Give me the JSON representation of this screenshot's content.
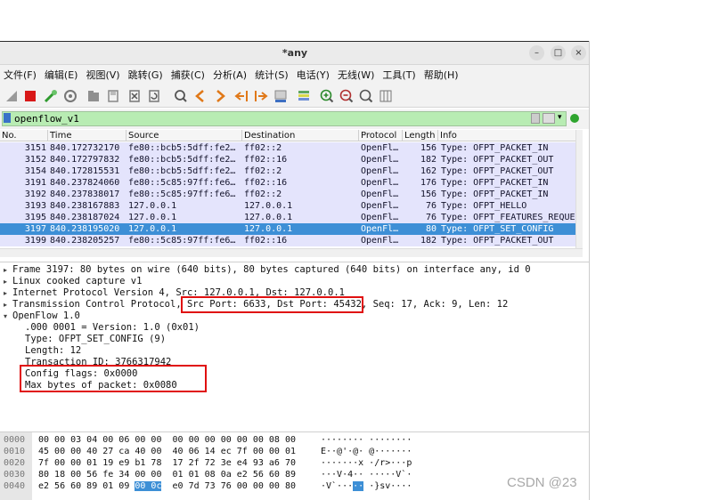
{
  "window": {
    "title": "*any",
    "minimize": "–",
    "maximize": "□",
    "close": "×"
  },
  "menu": [
    "文件(F)",
    "编辑(E)",
    "视图(V)",
    "跳转(G)",
    "捕获(C)",
    "分析(A)",
    "统计(S)",
    "电话(Y)",
    "无线(W)",
    "工具(T)",
    "帮助(H)"
  ],
  "filter": {
    "value": "openflow_v1"
  },
  "packet_list": {
    "columns": [
      "No.",
      "Time",
      "Source",
      "Destination",
      "Protocol",
      "Length",
      "Info"
    ],
    "rows": [
      {
        "no": "3151",
        "time": "840.172732170",
        "src": "fe80::bcb5:5dff:fe2…",
        "dst": "ff02::2",
        "proto": "OpenFl…",
        "len": "156",
        "info": "Type: OFPT_PACKET_IN"
      },
      {
        "no": "3152",
        "time": "840.172797832",
        "src": "fe80::bcb5:5dff:fe2…",
        "dst": "ff02::16",
        "proto": "OpenFl…",
        "len": "182",
        "info": "Type: OFPT_PACKET_OUT"
      },
      {
        "no": "3154",
        "time": "840.172815531",
        "src": "fe80::bcb5:5dff:fe2…",
        "dst": "ff02::2",
        "proto": "OpenFl…",
        "len": "162",
        "info": "Type: OFPT_PACKET_OUT"
      },
      {
        "no": "3191",
        "time": "840.237824060",
        "src": "fe80::5c85:97ff:fe6…",
        "dst": "ff02::16",
        "proto": "OpenFl…",
        "len": "176",
        "info": "Type: OFPT_PACKET_IN"
      },
      {
        "no": "3192",
        "time": "840.237838017",
        "src": "fe80::5c85:97ff:fe6…",
        "dst": "ff02::2",
        "proto": "OpenFl…",
        "len": "156",
        "info": "Type: OFPT_PACKET_IN"
      },
      {
        "no": "3193",
        "time": "840.238167883",
        "src": "127.0.0.1",
        "dst": "127.0.0.1",
        "proto": "OpenFl…",
        "len": "76",
        "info": "Type: OFPT_HELLO"
      },
      {
        "no": "3195",
        "time": "840.238187024",
        "src": "127.0.0.1",
        "dst": "127.0.0.1",
        "proto": "OpenFl…",
        "len": "76",
        "info": "Type: OFPT_FEATURES_REQUE:"
      },
      {
        "no": "3197",
        "time": "840.238195020",
        "src": "127.0.0.1",
        "dst": "127.0.0.1",
        "proto": "OpenFl…",
        "len": "80",
        "info": "Type: OFPT_SET_CONFIG"
      },
      {
        "no": "3199",
        "time": "840.238205257",
        "src": "fe80::5c85:97ff:fe6…",
        "dst": "ff02::16",
        "proto": "OpenFl…",
        "len": "182",
        "info": "Type: OFPT_PACKET_OUT"
      }
    ]
  },
  "details": {
    "frame": "Frame 3197: 80 bytes on wire (640 bits), 80 bytes captured (640 bits) on interface any, id 0",
    "linux": "Linux cooked capture v1",
    "ip": "Internet Protocol Version 4, Src: 127.0.0.1, Dst: 127.0.0.1",
    "tcp_prefix": "Transmission Control Protocol, ",
    "tcp_ports": "Src Port: 6633, Dst Port: 45432,",
    "tcp_suffix": " Seq: 17, Ack: 9, Len: 12",
    "openflow": "OpenFlow 1.0",
    "version": ".000 0001 = Version: 1.0 (0x01)",
    "type": "Type: OFPT_SET_CONFIG (9)",
    "length": "Length: 12",
    "transaction": "Transaction ID: 3766317942",
    "config_flags": "Config flags: 0x0000",
    "max_bytes": "Max bytes of packet: 0x0080"
  },
  "bytes": [
    {
      "offset": "0000",
      "hex": "00 00 03 04 00 06 00 00  00 00 00 00 00 00 08 00",
      "ascii": "········ ········"
    },
    {
      "offset": "0010",
      "hex": "45 00 00 40 27 ca 40 00  40 06 14 ec 7f 00 00 01",
      "ascii": "E··@'·@· @·······"
    },
    {
      "offset": "0020",
      "hex": "7f 00 00 01 19 e9 b1 78  17 2f 72 3e e4 93 a6 70",
      "ascii": "·······x ·/r>···p"
    },
    {
      "offset": "0030",
      "hex": "80 18 00 56 fe 34 00 00  01 01 08 0a e2 56 60 89",
      "ascii": "···V·4·· ·····V`·"
    },
    {
      "offset": "0040",
      "hex_a": "e2 56 60 89 01 09 ",
      "hex_hl": "00 0c",
      "hex_b": "  e0 7d 73 76 00 00 00 80",
      "ascii_a": "·V`···",
      "ascii_hl": "··",
      "ascii_b": " ·}sv····"
    }
  ],
  "watermark": "CSDN @23"
}
